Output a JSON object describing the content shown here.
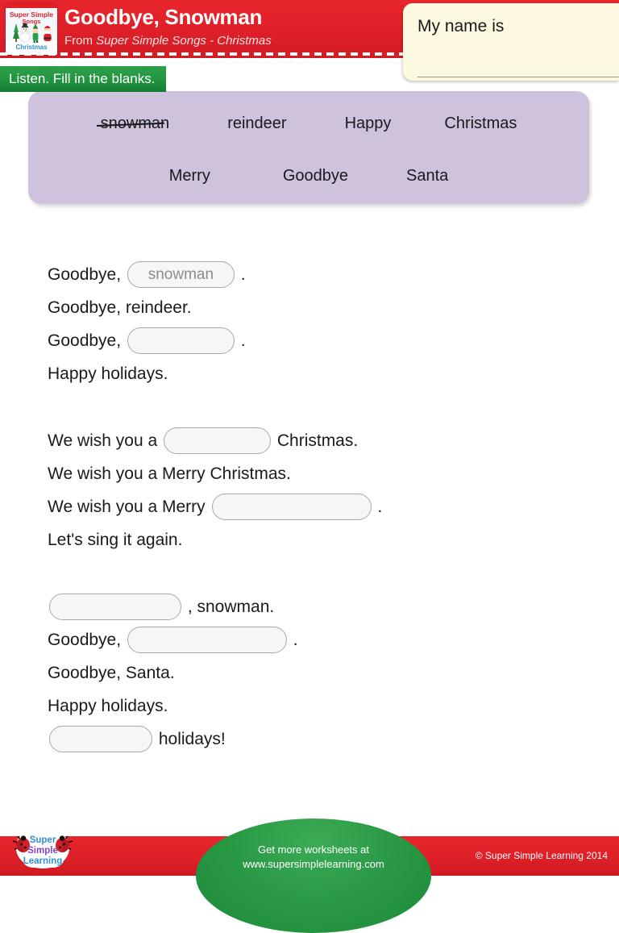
{
  "header": {
    "title": "Goodbye, Snowman",
    "subtitle_prefix": "From ",
    "subtitle_album": "Super Simple Songs - Christmas",
    "album_art_alt": "Super Simple Songs Christmas album cover",
    "album_art_line1": "Super Simple",
    "album_art_line2": "Songs",
    "album_art_line3": "Christmas",
    "bg_color": "#df1f28"
  },
  "name_box": {
    "label": "My name is",
    "value": "",
    "placeholder": "",
    "bg_color": "#fdf8e0"
  },
  "instruction": {
    "text": "Listen. Fill in the blanks.",
    "bg_color": "#239440"
  },
  "word_bank": {
    "bg_color": "#cfc2dd",
    "row1": [
      {
        "word": "snowman",
        "struck": true
      },
      {
        "word": "reindeer",
        "struck": false
      },
      {
        "word": "Happy",
        "struck": false
      },
      {
        "word": "Christmas",
        "struck": false
      }
    ],
    "row2": [
      {
        "word": "Merry",
        "struck": false
      },
      {
        "word": "Goodbye",
        "struck": false
      },
      {
        "word": "Santa",
        "struck": false
      }
    ]
  },
  "blank_style": {
    "fill_color": "#f5f6f5",
    "border_color": "#a8a8a8",
    "text_color": "#8b8b8b"
  },
  "lyrics": {
    "stanzas": [
      {
        "lines": [
          {
            "before": "Goodbye, ",
            "blank": "snowman",
            "blank_size": "md",
            "after": " ."
          },
          {
            "before": "Goodbye, reindeer.",
            "blank": null,
            "after": ""
          },
          {
            "before": "Goodbye, ",
            "blank": "",
            "blank_size": "md",
            "after": " ."
          },
          {
            "before": "Happy holidays.",
            "blank": null,
            "after": ""
          }
        ]
      },
      {
        "lines": [
          {
            "before": "We wish you a ",
            "blank": "",
            "blank_size": "md",
            "after": " Christmas."
          },
          {
            "before": "We wish you a Merry Christmas.",
            "blank": null,
            "after": ""
          },
          {
            "before": "We wish you a Merry ",
            "blank": "",
            "blank_size": "xl",
            "after": " ."
          },
          {
            "before": "Let's sing it again.",
            "blank": null,
            "after": ""
          }
        ]
      },
      {
        "lines": [
          {
            "before": "",
            "blank": "",
            "blank_size": "lg",
            "after": " , snowman."
          },
          {
            "before": "Goodbye, ",
            "blank": "",
            "blank_size": "xl",
            "after": " ."
          },
          {
            "before": "Goodbye, Santa.",
            "blank": null,
            "after": ""
          },
          {
            "before": "Happy holidays.",
            "blank": null,
            "after": ""
          },
          {
            "before": "",
            "blank": "",
            "blank_size": "sm",
            "after": " holidays!"
          }
        ]
      }
    ]
  },
  "footer": {
    "dome_line1": "Get more worksheets at",
    "dome_line2": "www.supersimplelearning.com",
    "copyright": "© Super Simple Learning 2014",
    "logo_line1": "Super",
    "logo_line2": "Simple",
    "logo_line3": "Learning",
    "bar_color": "#dd1f27",
    "dome_color": "#2b9a47"
  }
}
